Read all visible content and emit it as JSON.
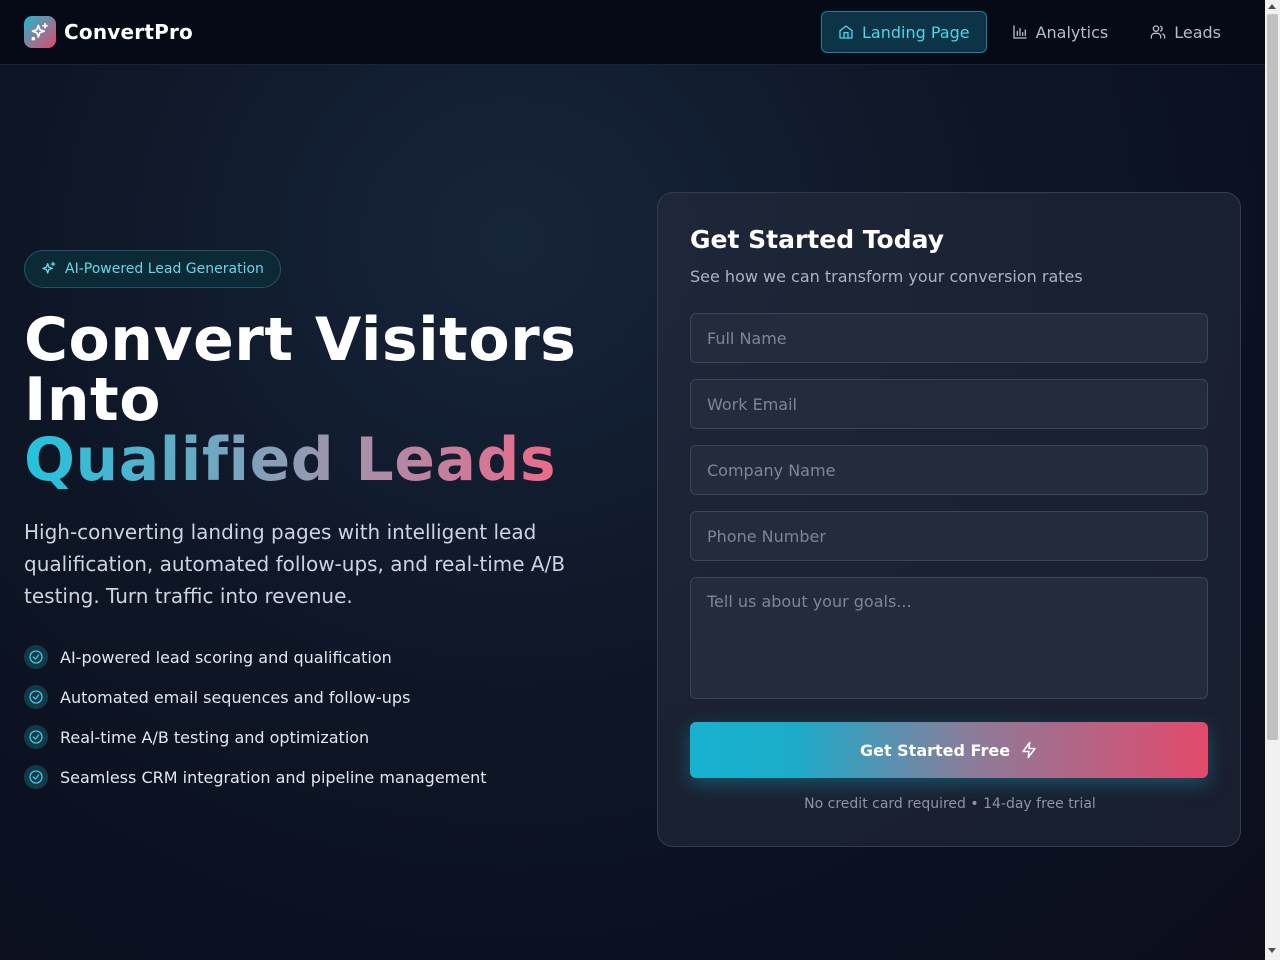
{
  "brand": {
    "name": "ConvertPro"
  },
  "nav": {
    "items": [
      {
        "label": "Landing Page",
        "icon": "home-icon",
        "active": true
      },
      {
        "label": "Analytics",
        "icon": "bar-chart-icon",
        "active": false
      },
      {
        "label": "Leads",
        "icon": "users-icon",
        "active": false
      }
    ]
  },
  "hero": {
    "badge": "AI-Powered Lead Generation",
    "title_line1": "Convert Visitors",
    "title_line2": "Into",
    "title_highlight": "Qualified Leads",
    "subtitle": "High-converting landing pages with intelligent lead qualification, automated follow-ups, and real-time A/B testing. Turn traffic into revenue.",
    "features": [
      "AI-powered lead scoring and qualification",
      "Automated email sequences and follow-ups",
      "Real-time A/B testing and optimization",
      "Seamless CRM integration and pipeline management"
    ]
  },
  "form": {
    "title": "Get Started Today",
    "subtitle": "See how we can transform your conversion rates",
    "fields": {
      "full_name": {
        "placeholder": "Full Name",
        "value": ""
      },
      "work_email": {
        "placeholder": "Work Email",
        "value": ""
      },
      "company_name": {
        "placeholder": "Company Name",
        "value": ""
      },
      "phone_number": {
        "placeholder": "Phone Number",
        "value": ""
      },
      "goals": {
        "placeholder": "Tell us about your goals...",
        "value": ""
      }
    },
    "submit_label": "Get Started Free",
    "footnote": "No credit card required • 14-day free trial"
  },
  "colors": {
    "accent_cyan": "#22c3dd",
    "accent_pink": "#e34a6b",
    "background": "#0e1626",
    "nav_active": "#4fd3ea"
  }
}
